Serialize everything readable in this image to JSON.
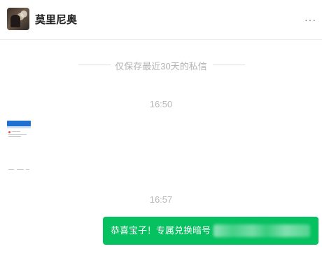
{
  "header": {
    "contact_name": "莫里尼奥",
    "more_label": "···"
  },
  "notice": {
    "text": "仅保存最近30天的私信"
  },
  "messages": [
    {
      "time": "16:50",
      "type": "image"
    },
    {
      "time": "16:57",
      "type": "text",
      "text": "恭喜宝子！专属兑换暗号",
      "redacted": true
    }
  ],
  "colors": {
    "bubble": "#05c160",
    "divider": "#ededed",
    "timestamp": "#b8b8b8"
  },
  "icons": {
    "avatar": "user-avatar",
    "more": "more-dots-icon"
  }
}
